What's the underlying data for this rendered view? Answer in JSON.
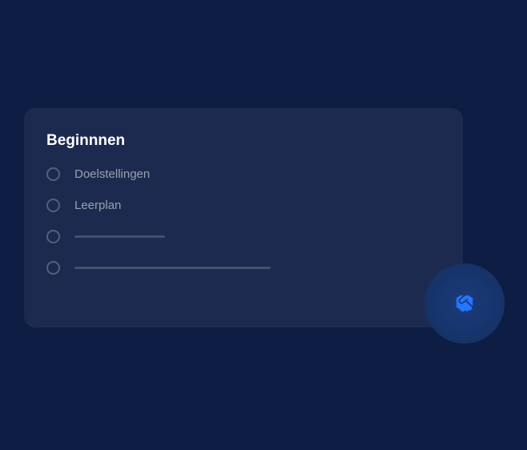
{
  "card": {
    "title": "Beginnnen",
    "items": [
      {
        "label": "Doelstellingen"
      },
      {
        "label": "Leerplan"
      }
    ]
  },
  "fab": {
    "icon": "handshake-icon"
  }
}
